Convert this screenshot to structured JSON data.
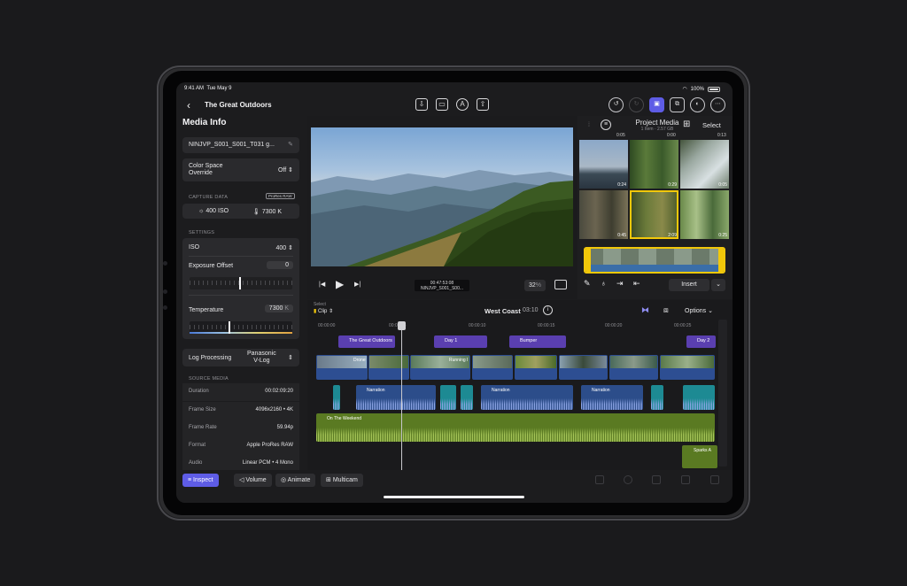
{
  "status": {
    "time": "9:41 AM",
    "date": "Tue May 9",
    "battery": "100%"
  },
  "nav": {
    "back": "‹",
    "title": "The Great Outdoors"
  },
  "inspector": {
    "title": "Media Info",
    "clip_name": "NINJVP_S001_S001_T031 g...",
    "color_space_label": "Color Space\nOverride",
    "color_space_value": "Off",
    "capture_data_header": "CAPTURE DATA",
    "capture_badge": "ProRes RAW",
    "iso_capture": "400 ISO",
    "kelvin_capture": "7300 K",
    "settings_header": "SETTINGS",
    "iso_label": "ISO",
    "iso_value": "400",
    "exposure_label": "Exposure Offset",
    "exposure_value": "0",
    "temperature_label": "Temperature",
    "temperature_value": "7300",
    "temperature_unit": "K",
    "log_label": "Log Processing",
    "log_value": "Panasonic\nV-Log",
    "source_header": "SOURCE MEDIA",
    "source_rows": [
      {
        "k": "Duration",
        "v": "00:02:09:20"
      },
      {
        "k": "Frame Size",
        "v": "4096x2160 • 4K"
      },
      {
        "k": "Frame Rate",
        "v": "59.94p"
      },
      {
        "k": "Format",
        "v": "Apple ProRes RAW"
      },
      {
        "k": "Audio",
        "v": "Linear PCM • 4 Mono"
      }
    ]
  },
  "viewer": {
    "timecode": "00:47:53:08",
    "clip_small": "NINJVP_S001_S00...",
    "zoom": "32",
    "zoom_unit": "%"
  },
  "browser": {
    "title": "Project Media",
    "subtitle": "1 Item · 2.57 GB",
    "select": "Select",
    "top_durations": [
      "0:05",
      "0:00",
      "0:13"
    ],
    "thumb_durations": [
      "0:24",
      "0:29",
      "0:05",
      "0:45",
      "2:09",
      "0:25"
    ],
    "insert": "Insert"
  },
  "timeline": {
    "select_label": "Select",
    "clip_mode": "Clip",
    "project": "West Coast",
    "duration": "03:10",
    "options": "Options",
    "ticks": [
      "00:00:00",
      "00:00:05",
      "00:00:10",
      "00:00:15",
      "00:00:20",
      "00:00:25"
    ],
    "titles": [
      {
        "label": "The Great Outdoors"
      },
      {
        "label": "Day 1"
      },
      {
        "label": "Bumper"
      },
      {
        "label": "Day 2"
      }
    ],
    "video_labels": [
      "Drone",
      "Running I"
    ],
    "narrations": [
      "Narration",
      "Narration",
      "Narration"
    ],
    "music": "On The Weekend",
    "music2": "Sparks A"
  },
  "bottom": {
    "inspect": "Inspect",
    "volume": "Volume",
    "animate": "Animate",
    "multicam": "Multicam"
  },
  "colors": {
    "accent": "#5e5ce6",
    "title_clip": "#5a3fb0",
    "video_clip": "#2d4e92",
    "audio_teal": "#1d8a93",
    "music": "#5a7a22",
    "selection": "#f2c80a"
  }
}
